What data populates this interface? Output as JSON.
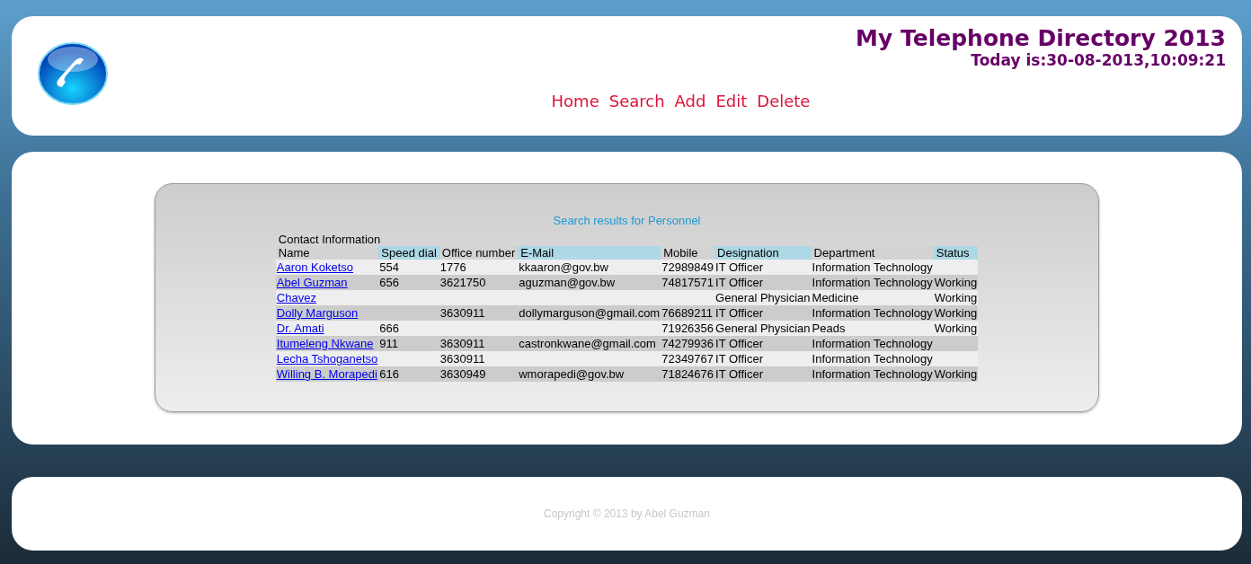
{
  "header": {
    "title": "My Telephone Directory 2013",
    "date_line": "Today is:30-08-2013,10:09:21",
    "nav": [
      "Home",
      "Search",
      "Add",
      "Edit",
      "Delete"
    ]
  },
  "results": {
    "heading": "Search results for Personnel",
    "caption": "Contact Information",
    "columns": [
      {
        "label": "Name",
        "highlighted": false
      },
      {
        "label": "Speed dial",
        "highlighted": true
      },
      {
        "label": "Office number",
        "highlighted": false
      },
      {
        "label": "E-Mail",
        "highlighted": true
      },
      {
        "label": "Mobile",
        "highlighted": false
      },
      {
        "label": "Designation",
        "highlighted": true
      },
      {
        "label": "Department",
        "highlighted": false
      },
      {
        "label": "Status",
        "highlighted": true
      }
    ],
    "rows": [
      [
        "Aaron Koketso",
        "554",
        "1776",
        "kkaaron@gov.bw",
        "72989849",
        "IT Officer",
        "Information Technology",
        ""
      ],
      [
        "Abel Guzman",
        "656",
        "3621750",
        "aguzman@gov.bw",
        "74817571",
        "IT Officer",
        "Information Technology",
        "Working"
      ],
      [
        "Chavez",
        "",
        "",
        "",
        "",
        "General Physician",
        "Medicine",
        "Working"
      ],
      [
        "Dolly Marguson",
        "",
        "3630911",
        "dollymarguson@gmail.com",
        "76689211",
        "IT Officer",
        "Information Technology",
        "Working"
      ],
      [
        "Dr. Amati",
        "666",
        "",
        "",
        "71926356",
        "General Physician",
        "Peads",
        "Working"
      ],
      [
        "Itumeleng Nkwane",
        "911",
        "3630911",
        "castronkwane@gmail.com",
        "74279936",
        "IT Officer",
        "Information Technology",
        ""
      ],
      [
        "Lecha Tshoganetso",
        "",
        "3630911",
        "",
        "72349767",
        "IT Officer",
        "Information Technology",
        ""
      ],
      [
        "Willing B. Morapedi",
        "616",
        "3630949",
        "wmorapedi@gov.bw",
        "71824676",
        "IT Officer",
        "Information Technology",
        "Working"
      ]
    ]
  },
  "footer": {
    "copyright": "Copyright © 2013 by Abel Guzman"
  }
}
